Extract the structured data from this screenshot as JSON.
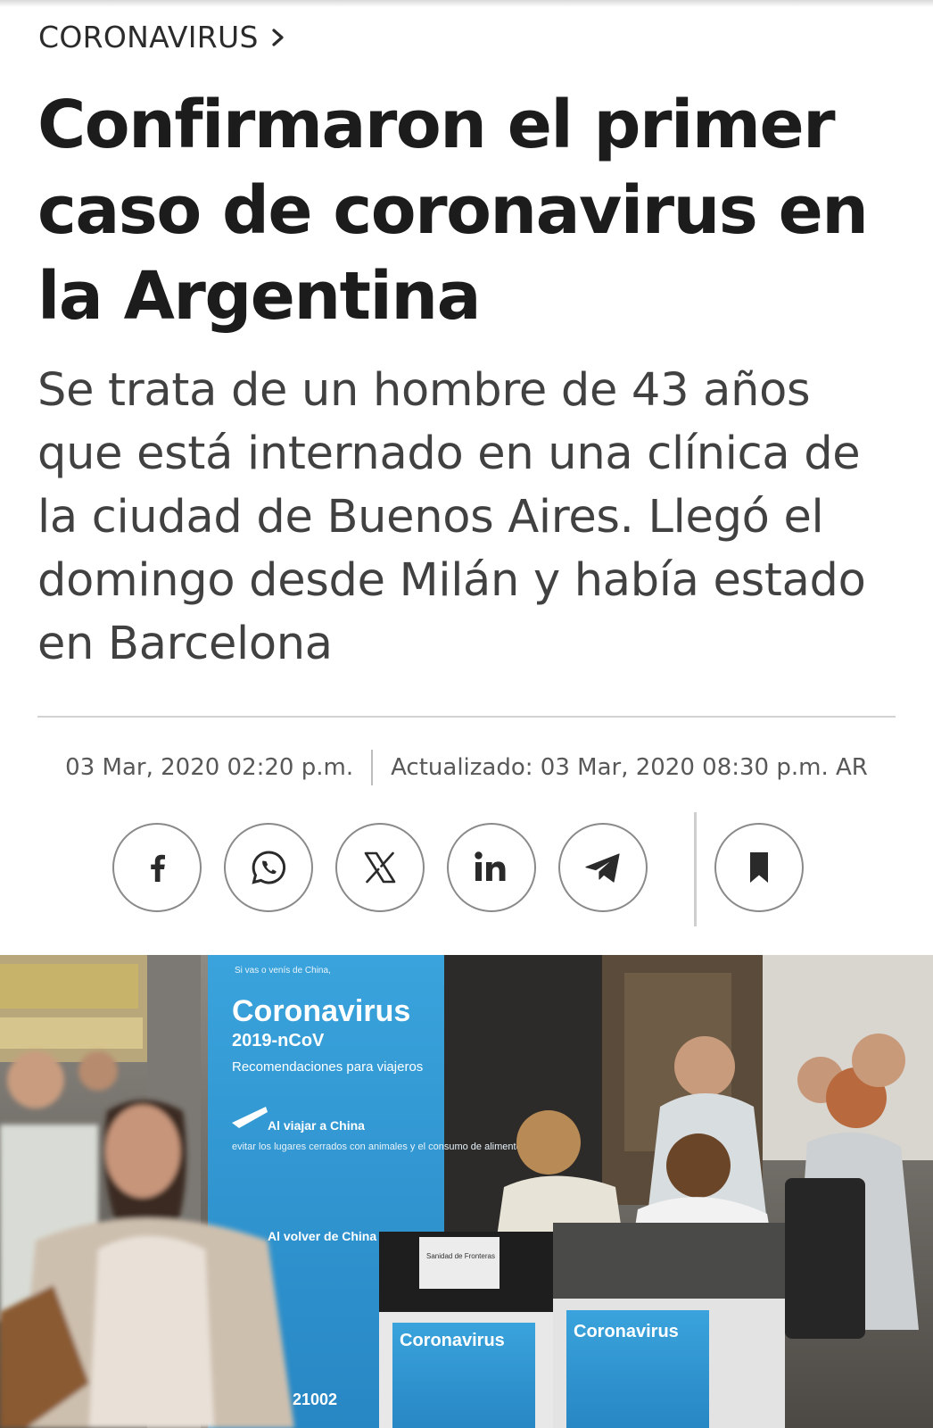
{
  "section": {
    "label": "CORONAVIRUS"
  },
  "article": {
    "headline": "Confirmaron el primer caso de coronavirus en la Argentina",
    "subtitle": "Se trata de un hombre de 43 años que está internado en una clínica de la ciudad de Buenos Aires. Llegó el domingo desde Milán y había estado en Barcelona",
    "published": "03 Mar, 2020 02:20 p.m.",
    "updated": "Actualizado: 03 Mar, 2020 08:30 p.m. AR"
  },
  "share_buttons": [
    "facebook-icon",
    "whatsapp-icon",
    "x-icon",
    "linkedin-icon",
    "telegram-icon"
  ],
  "bookmark_icon": "bookmark-icon",
  "hero": {
    "banner_small": "Si vas o venís de China,",
    "banner_title": "Coronavirus",
    "banner_code": "2019-nCoV",
    "banner_sub": "Recomendaciones para viajeros",
    "banner_trip_heading": "Al viajar a China",
    "banner_trip_text": "evitar los lugares cerrados con animales y el consumo de alimentos",
    "banner_return_heading": "Al volver de China",
    "banner_phone": "21002",
    "desk_label": "Sanidad de Fronteras",
    "poster_title": "Coronavirus"
  },
  "colors": {
    "accent": "#1e1e1e",
    "banner_blue": "#2c9ad4",
    "border": "#8a8a8a"
  }
}
